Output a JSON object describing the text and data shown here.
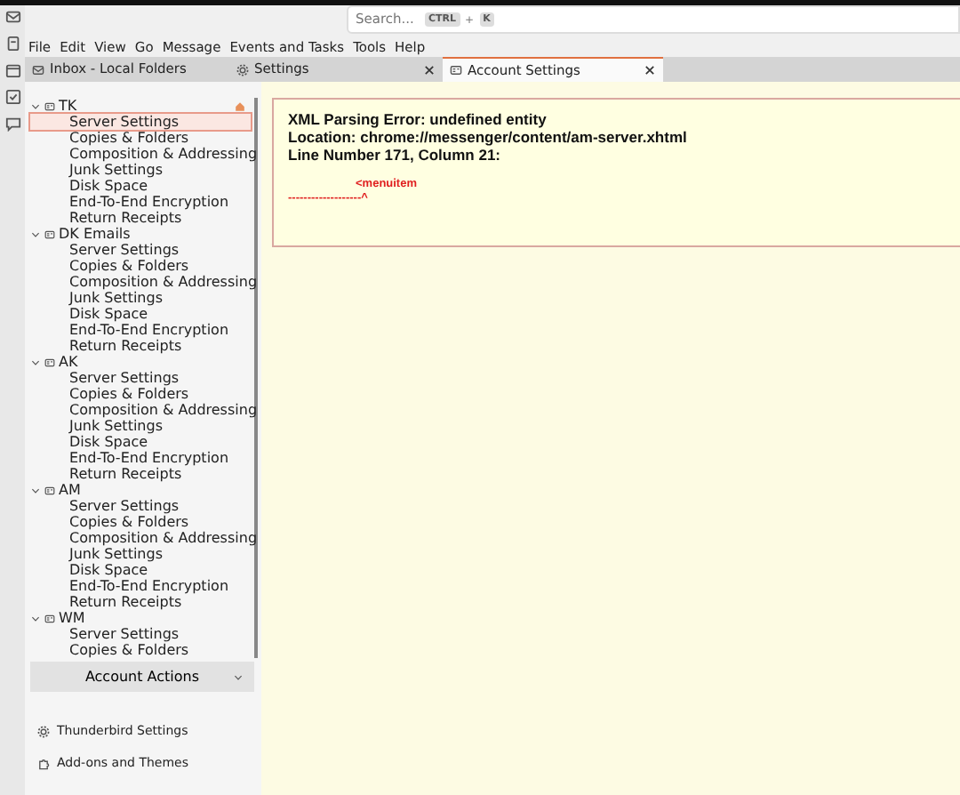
{
  "search": {
    "placeholder": "Search...",
    "shortcut_keys": [
      "CTRL",
      "K"
    ],
    "shortcut_joiner": "+"
  },
  "menu": [
    "File",
    "Edit",
    "View",
    "Go",
    "Message",
    "Events and Tasks",
    "Tools",
    "Help"
  ],
  "tabs": [
    {
      "label": "Inbox - Local Folders",
      "kind": "mail",
      "selected": false,
      "closable": false
    },
    {
      "label": "Settings",
      "kind": "settings",
      "selected": false,
      "closable": true
    },
    {
      "label": "Account Settings",
      "kind": "account",
      "selected": true,
      "closable": true
    }
  ],
  "accounts": [
    {
      "name": "TK",
      "expanded": true,
      "default": true,
      "children": [
        {
          "label": "Server Settings",
          "selected": true
        },
        {
          "label": "Copies & Folders",
          "selected": false
        },
        {
          "label": "Composition & Addressing",
          "selected": false
        },
        {
          "label": "Junk Settings",
          "selected": false
        },
        {
          "label": "Disk Space",
          "selected": false
        },
        {
          "label": "End-To-End Encryption",
          "selected": false
        },
        {
          "label": "Return Receipts",
          "selected": false
        }
      ]
    },
    {
      "name": "DK Emails",
      "expanded": true,
      "default": false,
      "children": [
        {
          "label": "Server Settings",
          "selected": false
        },
        {
          "label": "Copies & Folders",
          "selected": false
        },
        {
          "label": "Composition & Addressing",
          "selected": false
        },
        {
          "label": "Junk Settings",
          "selected": false
        },
        {
          "label": "Disk Space",
          "selected": false
        },
        {
          "label": "End-To-End Encryption",
          "selected": false
        },
        {
          "label": "Return Receipts",
          "selected": false
        }
      ]
    },
    {
      "name": "AK",
      "expanded": true,
      "default": false,
      "children": [
        {
          "label": "Server Settings",
          "selected": false
        },
        {
          "label": "Copies & Folders",
          "selected": false
        },
        {
          "label": "Composition & Addressing",
          "selected": false
        },
        {
          "label": "Junk Settings",
          "selected": false
        },
        {
          "label": "Disk Space",
          "selected": false
        },
        {
          "label": "End-To-End Encryption",
          "selected": false
        },
        {
          "label": "Return Receipts",
          "selected": false
        }
      ]
    },
    {
      "name": "AM",
      "expanded": true,
      "default": false,
      "children": [
        {
          "label": "Server Settings",
          "selected": false
        },
        {
          "label": "Copies & Folders",
          "selected": false
        },
        {
          "label": "Composition & Addressing",
          "selected": false
        },
        {
          "label": "Junk Settings",
          "selected": false
        },
        {
          "label": "Disk Space",
          "selected": false
        },
        {
          "label": "End-To-End Encryption",
          "selected": false
        },
        {
          "label": "Return Receipts",
          "selected": false
        }
      ]
    },
    {
      "name": "WM",
      "expanded": true,
      "default": false,
      "children": [
        {
          "label": "Server Settings",
          "selected": false
        },
        {
          "label": "Copies & Folders",
          "selected": false
        }
      ]
    }
  ],
  "account_actions": "Account Actions",
  "footer_links": [
    {
      "label": "Thunderbird Settings",
      "kind": "settings"
    },
    {
      "label": "Add-ons and Themes",
      "kind": "addons"
    }
  ],
  "error": {
    "lines": [
      "XML Parsing Error: undefined entity",
      "Location: chrome://messenger/content/am-server.xhtml",
      "Line Number 171, Column 21:"
    ],
    "source": "<menuitem",
    "pointer": "-------------------^"
  }
}
